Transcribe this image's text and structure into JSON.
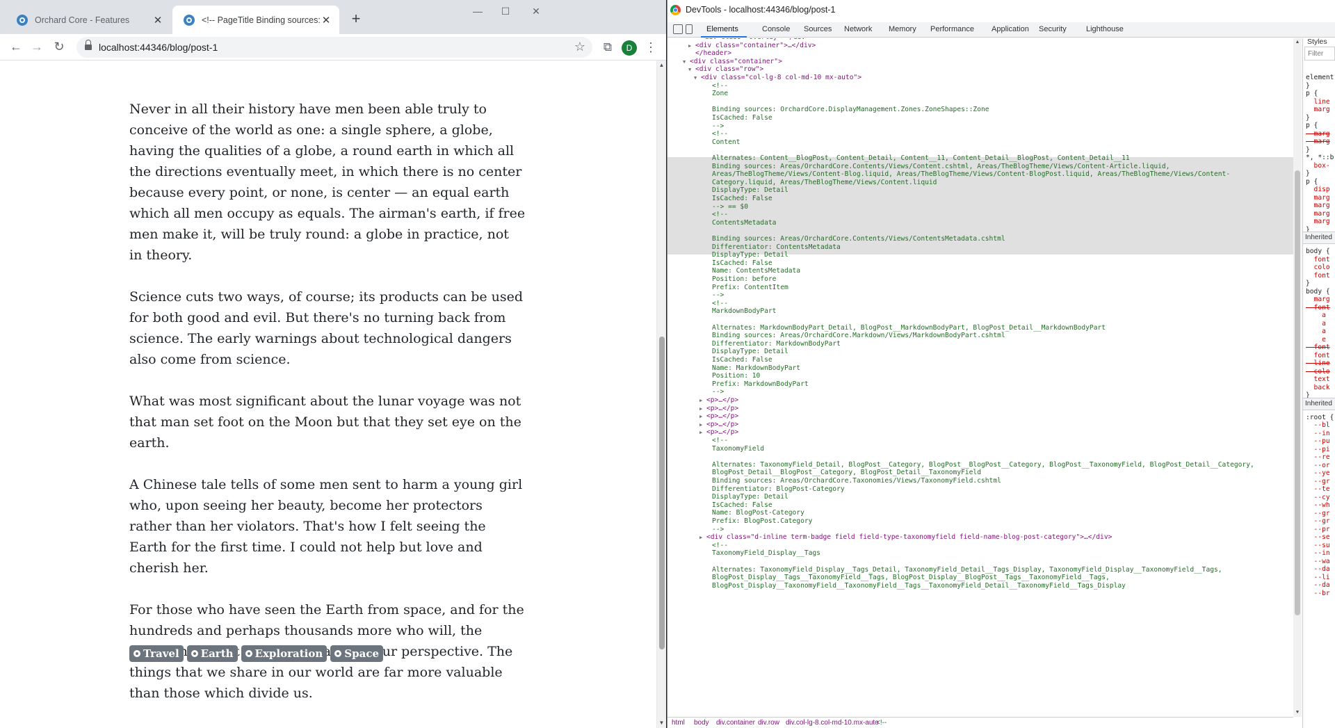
{
  "browser": {
    "tabs": [
      {
        "title": "Orchard Core - Features",
        "active": false
      },
      {
        "title": "<!-- PageTitle Binding sources: O",
        "active": true
      }
    ],
    "url": "localhost:44346/blog/post-1",
    "avatar_letter": "D"
  },
  "article": {
    "paragraphs": [
      "Never in all their history have men been able truly to conceive of the world as one: a single sphere, a globe, having the qualities of a globe, a round earth in which all the directions eventually meet, in which there is no center because every point, or none, is center — an equal earth which all men occupy as equals. The airman's earth, if free men make it, will be truly round: a globe in practice, not in theory.",
      "Science cuts two ways, of course; its products can be used for both good and evil. But there's no turning back from science. The early warnings about technological dangers also come from science.",
      "What was most significant about the lunar voyage was not that man set foot on the Moon but that they set eye on the earth.",
      "A Chinese tale tells of some men sent to harm a young girl who, upon seeing her beauty, become her protectors rather than her violators. That's how I felt seeing the Earth for the first time. I could not help but love and cherish her.",
      "For those who have seen the Earth from space, and for the hundreds and perhaps thousands more who will, the experience most certainly changes your perspective. The things that we share in our world are far more valuable than those which divide us."
    ],
    "tags": [
      "Travel",
      "Earth",
      "Exploration",
      "Space"
    ]
  },
  "devtools": {
    "window_title": "DevTools - localhost:44346/blog/post-1",
    "panel_tabs": [
      "Elements",
      "Console",
      "Sources",
      "Network",
      "Memory",
      "Performance",
      "Application",
      "Security",
      "Lighthouse"
    ],
    "selected_panel": "Elements",
    "dom_lines": [
      {
        "indent": 5,
        "arrow": "",
        "kind": "tag",
        "text": "<div class=\"overlay\"></div>"
      },
      {
        "indent": 4,
        "arrow": "▶",
        "kind": "tag",
        "text": "<div class=\"container\">…</div>"
      },
      {
        "indent": 4,
        "arrow": "",
        "kind": "tag",
        "text": "</header>"
      },
      {
        "indent": 3,
        "arrow": "▼",
        "kind": "tag",
        "text": "<div class=\"container\">"
      },
      {
        "indent": 4,
        "arrow": "▼",
        "kind": "tag",
        "text": "<div class=\"row\">"
      },
      {
        "indent": 5,
        "arrow": "▼",
        "kind": "tag",
        "text": "<div class=\"col-lg-8 col-md-10 mx-auto\">"
      },
      {
        "indent": 7,
        "arrow": "",
        "kind": "comment",
        "text": "<!--"
      },
      {
        "indent": 7,
        "arrow": "",
        "kind": "comment",
        "text": "Zone"
      },
      {
        "indent": 7,
        "arrow": "",
        "kind": "comment",
        "text": ""
      },
      {
        "indent": 7,
        "arrow": "",
        "kind": "comment",
        "text": "Binding sources: OrchardCore.DisplayManagement.Zones.ZoneShapes::Zone"
      },
      {
        "indent": 7,
        "arrow": "",
        "kind": "comment",
        "text": "IsCached: False"
      },
      {
        "indent": 7,
        "arrow": "",
        "kind": "comment",
        "text": "-->"
      },
      {
        "indent": 7,
        "arrow": "",
        "kind": "comment",
        "text": "<!--"
      },
      {
        "indent": 7,
        "arrow": "",
        "kind": "comment",
        "text": "Content"
      },
      {
        "indent": 7,
        "arrow": "",
        "kind": "comment",
        "text": ""
      },
      {
        "indent": 7,
        "arrow": "",
        "kind": "comment",
        "text": "Alternates: Content__BlogPost, Content_Detail, Content__11, Content_Detail__BlogPost, Content_Detail__11"
      },
      {
        "indent": 7,
        "arrow": "",
        "kind": "comment",
        "text": "Binding sources: Areas/OrchardCore.Contents/Views/Content.cshtml, Areas/TheBlogTheme/Views/Content-Article.liquid,"
      },
      {
        "indent": 7,
        "arrow": "",
        "kind": "comment",
        "text": "Areas/TheBlogTheme/Views/Content-Blog.liquid, Areas/TheBlogTheme/Views/Content-BlogPost.liquid, Areas/TheBlogTheme/Views/Content-"
      },
      {
        "indent": 7,
        "arrow": "",
        "kind": "comment",
        "text": "Category.liquid, Areas/TheBlogTheme/Views/Content.liquid"
      },
      {
        "indent": 7,
        "arrow": "",
        "kind": "comment",
        "text": "DisplayType: Detail"
      },
      {
        "indent": 7,
        "arrow": "",
        "kind": "comment",
        "text": "IsCached: False"
      },
      {
        "indent": 7,
        "arrow": "",
        "kind": "comment",
        "text": "--> == $0"
      },
      {
        "indent": 7,
        "arrow": "",
        "kind": "comment",
        "text": "<!--"
      },
      {
        "indent": 7,
        "arrow": "",
        "kind": "comment",
        "text": "ContentsMetadata"
      },
      {
        "indent": 7,
        "arrow": "",
        "kind": "comment",
        "text": ""
      },
      {
        "indent": 7,
        "arrow": "",
        "kind": "comment",
        "text": "Binding sources: Areas/OrchardCore.Contents/Views/ContentsMetadata.cshtml"
      },
      {
        "indent": 7,
        "arrow": "",
        "kind": "comment",
        "text": "Differentiator: ContentsMetadata"
      },
      {
        "indent": 7,
        "arrow": "",
        "kind": "comment",
        "text": "DisplayType: Detail"
      },
      {
        "indent": 7,
        "arrow": "",
        "kind": "comment",
        "text": "IsCached: False"
      },
      {
        "indent": 7,
        "arrow": "",
        "kind": "comment",
        "text": "Name: ContentsMetadata"
      },
      {
        "indent": 7,
        "arrow": "",
        "kind": "comment",
        "text": "Position: before"
      },
      {
        "indent": 7,
        "arrow": "",
        "kind": "comment",
        "text": "Prefix: ContentItem"
      },
      {
        "indent": 7,
        "arrow": "",
        "kind": "comment",
        "text": "-->"
      },
      {
        "indent": 7,
        "arrow": "",
        "kind": "comment",
        "text": "<!--"
      },
      {
        "indent": 7,
        "arrow": "",
        "kind": "comment",
        "text": "MarkdownBodyPart"
      },
      {
        "indent": 7,
        "arrow": "",
        "kind": "comment",
        "text": ""
      },
      {
        "indent": 7,
        "arrow": "",
        "kind": "comment",
        "text": "Alternates: MarkdownBodyPart_Detail, BlogPost__MarkdownBodyPart, BlogPost_Detail__MarkdownBodyPart"
      },
      {
        "indent": 7,
        "arrow": "",
        "kind": "comment",
        "text": "Binding sources: Areas/OrchardCore.Markdown/Views/MarkdownBodyPart.cshtml"
      },
      {
        "indent": 7,
        "arrow": "",
        "kind": "comment",
        "text": "Differentiator: MarkdownBodyPart"
      },
      {
        "indent": 7,
        "arrow": "",
        "kind": "comment",
        "text": "DisplayType: Detail"
      },
      {
        "indent": 7,
        "arrow": "",
        "kind": "comment",
        "text": "IsCached: False"
      },
      {
        "indent": 7,
        "arrow": "",
        "kind": "comment",
        "text": "Name: MarkdownBodyPart"
      },
      {
        "indent": 7,
        "arrow": "",
        "kind": "comment",
        "text": "Position: 10"
      },
      {
        "indent": 7,
        "arrow": "",
        "kind": "comment",
        "text": "Prefix: MarkdownBodyPart"
      },
      {
        "indent": 7,
        "arrow": "",
        "kind": "comment",
        "text": "-->"
      },
      {
        "indent": 6,
        "arrow": "▶",
        "kind": "tag",
        "text": "<p>…</p>"
      },
      {
        "indent": 6,
        "arrow": "▶",
        "kind": "tag",
        "text": "<p>…</p>"
      },
      {
        "indent": 6,
        "arrow": "▶",
        "kind": "tag",
        "text": "<p>…</p>"
      },
      {
        "indent": 6,
        "arrow": "▶",
        "kind": "tag",
        "text": "<p>…</p>"
      },
      {
        "indent": 6,
        "arrow": "▶",
        "kind": "tag",
        "text": "<p>…</p>"
      },
      {
        "indent": 7,
        "arrow": "",
        "kind": "comment",
        "text": "<!--"
      },
      {
        "indent": 7,
        "arrow": "",
        "kind": "comment",
        "text": "TaxonomyField"
      },
      {
        "indent": 7,
        "arrow": "",
        "kind": "comment",
        "text": ""
      },
      {
        "indent": 7,
        "arrow": "",
        "kind": "comment",
        "text": "Alternates: TaxonomyField_Detail, BlogPost__Category, BlogPost__BlogPost__Category, BlogPost__TaxonomyField, BlogPost_Detail__Category,"
      },
      {
        "indent": 7,
        "arrow": "",
        "kind": "comment",
        "text": "BlogPost_Detail__BlogPost__Category, BlogPost_Detail__TaxonomyField"
      },
      {
        "indent": 7,
        "arrow": "",
        "kind": "comment",
        "text": "Binding sources: Areas/OrchardCore.Taxonomies/Views/TaxonomyField.cshtml"
      },
      {
        "indent": 7,
        "arrow": "",
        "kind": "comment",
        "text": "Differentiator: BlogPost-Category"
      },
      {
        "indent": 7,
        "arrow": "",
        "kind": "comment",
        "text": "DisplayType: Detail"
      },
      {
        "indent": 7,
        "arrow": "",
        "kind": "comment",
        "text": "IsCached: False"
      },
      {
        "indent": 7,
        "arrow": "",
        "kind": "comment",
        "text": "Name: BlogPost-Category"
      },
      {
        "indent": 7,
        "arrow": "",
        "kind": "comment",
        "text": "Prefix: BlogPost.Category"
      },
      {
        "indent": 7,
        "arrow": "",
        "kind": "comment",
        "text": "-->"
      },
      {
        "indent": 6,
        "arrow": "▶",
        "kind": "tag",
        "text": "<div class=\"d-inline term-badge field field-type-taxonomyfield field-name-blog-post-category\">…</div>"
      },
      {
        "indent": 7,
        "arrow": "",
        "kind": "comment",
        "text": "<!--"
      },
      {
        "indent": 7,
        "arrow": "",
        "kind": "comment",
        "text": "TaxonomyField_Display__Tags"
      },
      {
        "indent": 7,
        "arrow": "",
        "kind": "comment",
        "text": ""
      },
      {
        "indent": 7,
        "arrow": "",
        "kind": "comment",
        "text": "Alternates: TaxonomyField_Display__Tags_Detail, TaxonomyField_Detail__Tags_Display, TaxonomyField_Display__TaxonomyField__Tags,"
      },
      {
        "indent": 7,
        "arrow": "",
        "kind": "comment",
        "text": "BlogPost_Display__Tags__TaxonomyField__Tags, BlogPost_Display__BlogPost__Tags__TaxonomyField__Tags,"
      },
      {
        "indent": 7,
        "arrow": "",
        "kind": "comment",
        "text": "BlogPost_Display__TaxonomyField__TaxonomyField__Tags__TaxonomyField_Detail__TaxonomyField__Tags_Display"
      }
    ],
    "breadcrumb": [
      "html",
      "body",
      "div.container",
      "div.row",
      "div.col-lg-8.col-md-10.mx-auto",
      "<!--"
    ],
    "styles": {
      "header": "Styles",
      "filter_placeholder": "Filter",
      "lines": [
        {
          "text": "element",
          "style": "normal"
        },
        {
          "text": "}",
          "style": "normal"
        },
        {
          "text": "p {",
          "style": "normal"
        },
        {
          "text": "  line",
          "style": "red"
        },
        {
          "text": "  marg",
          "style": "red"
        },
        {
          "text": "}",
          "style": "normal"
        },
        {
          "text": "p {",
          "style": "normal"
        },
        {
          "text": "  marg",
          "style": "strike"
        },
        {
          "text": "  marg",
          "style": "strike"
        },
        {
          "text": "}",
          "style": "normal"
        },
        {
          "text": "*, *::b",
          "style": "normal"
        },
        {
          "text": "  box-",
          "style": "red"
        },
        {
          "text": "}",
          "style": "normal"
        },
        {
          "text": "p {",
          "style": "normal"
        },
        {
          "text": "  disp",
          "style": "red"
        },
        {
          "text": "  marg",
          "style": "red"
        },
        {
          "text": "  marg",
          "style": "red"
        },
        {
          "text": "  marg",
          "style": "red"
        },
        {
          "text": "  marg",
          "style": "red"
        },
        {
          "text": "}",
          "style": "normal"
        },
        {
          "text": "Inherited",
          "style": "section"
        },
        {
          "text": "body {",
          "style": "normal"
        },
        {
          "text": "  font",
          "style": "red"
        },
        {
          "text": "  colo",
          "style": "red"
        },
        {
          "text": "  font",
          "style": "red"
        },
        {
          "text": "}",
          "style": "normal"
        },
        {
          "text": "body {",
          "style": "normal"
        },
        {
          "text": "  marg",
          "style": "red"
        },
        {
          "text": "  font",
          "style": "strike"
        },
        {
          "text": "    a",
          "style": "red"
        },
        {
          "text": "    a",
          "style": "red"
        },
        {
          "text": "    a",
          "style": "red"
        },
        {
          "text": "    e",
          "style": "red"
        },
        {
          "text": "  font",
          "style": "strike"
        },
        {
          "text": "  font",
          "style": "red"
        },
        {
          "text": "  line",
          "style": "strike"
        },
        {
          "text": "  colo",
          "style": "strike"
        },
        {
          "text": "  text",
          "style": "red"
        },
        {
          "text": "  back",
          "style": "red"
        },
        {
          "text": "}",
          "style": "normal"
        },
        {
          "text": "Inherited",
          "style": "section"
        },
        {
          "text": ":root {",
          "style": "normal"
        },
        {
          "text": "  --bl",
          "style": "red"
        },
        {
          "text": "  --in",
          "style": "red"
        },
        {
          "text": "  --pu",
          "style": "red"
        },
        {
          "text": "  --pi",
          "style": "red"
        },
        {
          "text": "  --re",
          "style": "red"
        },
        {
          "text": "  --or",
          "style": "red"
        },
        {
          "text": "  --ye",
          "style": "red"
        },
        {
          "text": "  --gr",
          "style": "red"
        },
        {
          "text": "  --te",
          "style": "red"
        },
        {
          "text": "  --cy",
          "style": "red"
        },
        {
          "text": "  --wh",
          "style": "red"
        },
        {
          "text": "  --gr",
          "style": "red"
        },
        {
          "text": "  --gr",
          "style": "red"
        },
        {
          "text": "  --pr",
          "style": "red"
        },
        {
          "text": "  --se",
          "style": "red"
        },
        {
          "text": "  --su",
          "style": "red"
        },
        {
          "text": "  --in",
          "style": "red"
        },
        {
          "text": "  --wa",
          "style": "red"
        },
        {
          "text": "  --da",
          "style": "red"
        },
        {
          "text": "  --li",
          "style": "red"
        },
        {
          "text": "  --da",
          "style": "red"
        },
        {
          "text": "  --br",
          "style": "red"
        }
      ]
    }
  },
  "colors": {
    "tag_badge": "#6c757d",
    "selection_highlight": "#e0e0e0",
    "devtools_accent": "#1a73e8"
  }
}
